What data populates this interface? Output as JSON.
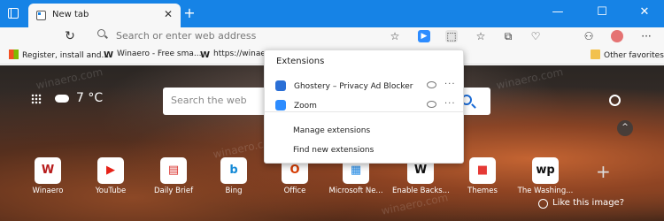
{
  "colors": {
    "titlebar": "#1683e6",
    "accent": "#1b6bd6"
  },
  "tab": {
    "title": "New tab",
    "close_glyph": "✕"
  },
  "window": {
    "new_tab_glyph": "+",
    "minimize_glyph": "—",
    "maximize_glyph": "☐",
    "close_glyph": "✕"
  },
  "address_bar": {
    "placeholder": "Search or enter web address"
  },
  "favorites": {
    "items": [
      {
        "label": "Register, install and...",
        "icon": "windows-logo-icon"
      },
      {
        "label": "Winaero - Free sma...",
        "icon": "winaero-w-icon"
      },
      {
        "label": "https://winaero",
        "icon": "winaero-w-icon"
      }
    ],
    "other": "Other favorites",
    "favicon_w": "W"
  },
  "ntp": {
    "temperature": "7 °C",
    "search_placeholder": "Search the web",
    "like_image": "Like this image?",
    "collapse_glyph": "^",
    "add_glyph": "+",
    "watermark": "winaero.com",
    "tiles": [
      {
        "label": "Winaero",
        "glyph": "W",
        "color": "#b71c1c"
      },
      {
        "label": "YouTube",
        "glyph": "▶",
        "color": "#e62117"
      },
      {
        "label": "Daily Brief",
        "glyph": "▤",
        "color": "#d9302c"
      },
      {
        "label": "Bing",
        "glyph": "b",
        "color": "#158ad6"
      },
      {
        "label": "Office",
        "glyph": "O",
        "color": "#d83b01"
      },
      {
        "label": "Microsoft Ne...",
        "glyph": "▦",
        "color": "#1e88e5"
      },
      {
        "label": "Enable Backs...",
        "glyph": "W",
        "color": "#111"
      },
      {
        "label": "Themes",
        "glyph": "■",
        "color": "#e53935"
      },
      {
        "label": "The Washing...",
        "glyph": "wp",
        "color": "#111"
      }
    ]
  },
  "extensions_panel": {
    "heading": "Extensions",
    "items": [
      {
        "name": "Ghostery – Privacy Ad Blocker",
        "color": "#2a6fd6",
        "more": "···"
      },
      {
        "name": "Zoom",
        "color": "#2d8cff",
        "more": "···"
      }
    ],
    "manage": "Manage extensions",
    "find": "Find new extensions"
  }
}
